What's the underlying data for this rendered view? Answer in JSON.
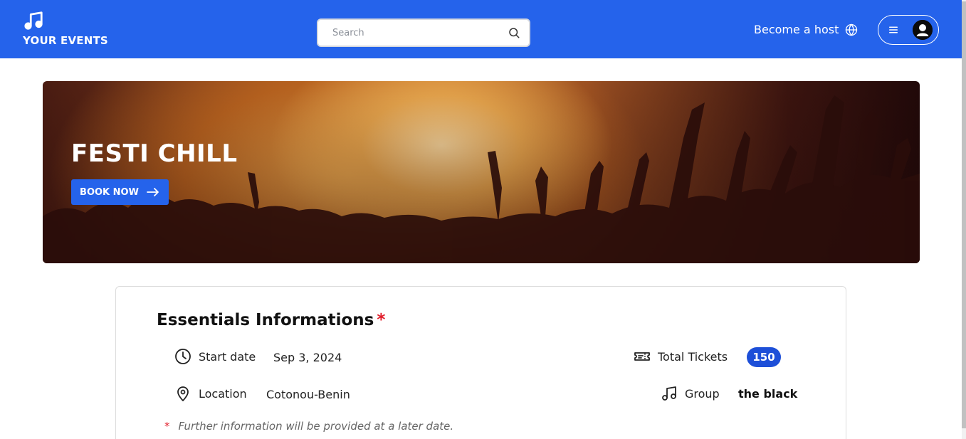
{
  "header": {
    "brand": "YOUR EVENTS",
    "search_placeholder": "Search",
    "host_link": "Become a host"
  },
  "hero": {
    "title": "FESTI CHILL",
    "cta_label": "BOOK NOW"
  },
  "essentials": {
    "title": "Essentials Informations",
    "required_mark": "*",
    "start_date_label": "Start date",
    "start_date_value": "Sep 3, 2024",
    "location_label": "Location",
    "location_value": "Cotonou-Benin",
    "total_tickets_label": "Total Tickets",
    "total_tickets_value": "150",
    "group_label": "Group",
    "group_value": "the black",
    "note_mark": "*",
    "note": "Further information will be provided at a later date."
  },
  "colors": {
    "primary": "#2563eb",
    "badge": "#1d4fd8",
    "required": "#e11d2a"
  },
  "icons": [
    "music-note-icon",
    "search-icon",
    "globe-icon",
    "menu-icon",
    "user-avatar-icon",
    "arrow-right-icon",
    "clock-icon",
    "map-pin-icon",
    "ticket-icon",
    "music-icon"
  ]
}
